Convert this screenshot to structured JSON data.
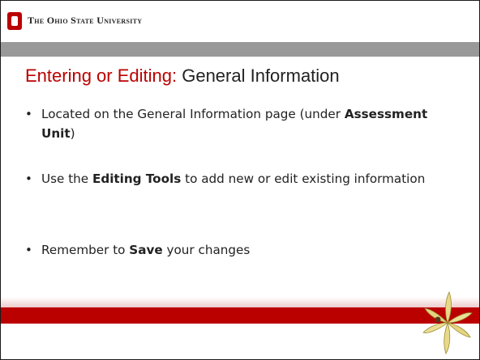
{
  "header": {
    "university_name": "The Ohio State University",
    "logo_icon": "ohio-state-block-o-icon",
    "brand_color": "#bb0000"
  },
  "slide": {
    "title_accent": "Entering or Editing:",
    "title_rest": " General Information",
    "bullets": [
      {
        "before": "Located on the General Information page (under ",
        "bold": "Assessment Unit",
        "after": ")"
      },
      {
        "before": "Use the ",
        "bold": "Editing Tools",
        "after": " to add new or edit existing information"
      },
      {
        "before": "Remember to ",
        "bold": "Save",
        "after": " your changes"
      }
    ],
    "decoration_icon": "buckeye-leaf-icon"
  }
}
